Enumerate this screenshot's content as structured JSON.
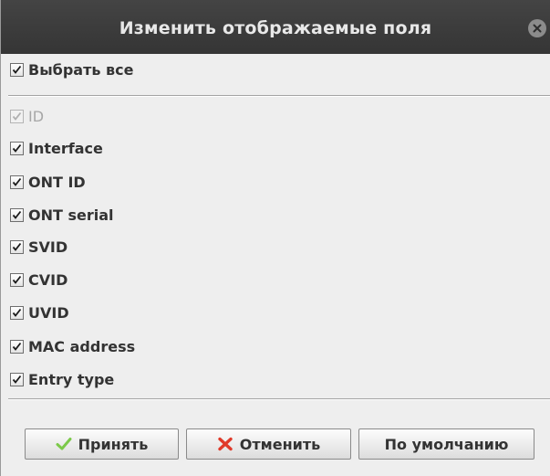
{
  "dialog": {
    "title": "Изменить отображаемые поля",
    "close_icon": "close-icon"
  },
  "select_all": {
    "label": "Выбрать все",
    "checked": true
  },
  "fields": [
    {
      "label": "ID",
      "checked": true,
      "enabled": false
    },
    {
      "label": "Interface",
      "checked": true,
      "enabled": true
    },
    {
      "label": "ONT ID",
      "checked": true,
      "enabled": true
    },
    {
      "label": "ONT serial",
      "checked": true,
      "enabled": true
    },
    {
      "label": "SVID",
      "checked": true,
      "enabled": true
    },
    {
      "label": "CVID",
      "checked": true,
      "enabled": true
    },
    {
      "label": "UVID",
      "checked": true,
      "enabled": true
    },
    {
      "label": "MAC address",
      "checked": true,
      "enabled": true
    },
    {
      "label": "Entry type",
      "checked": true,
      "enabled": true
    }
  ],
  "buttons": {
    "accept": {
      "label": "Принять",
      "icon": "checkmark-icon",
      "icon_color": "#7cc94a"
    },
    "cancel": {
      "label": "Отменить",
      "icon": "cross-icon",
      "icon_color": "#e03a2a"
    },
    "default": {
      "label": "По умолчанию"
    }
  },
  "colors": {
    "titlebar": "#3d3d3d",
    "background": "#eeeeee"
  }
}
